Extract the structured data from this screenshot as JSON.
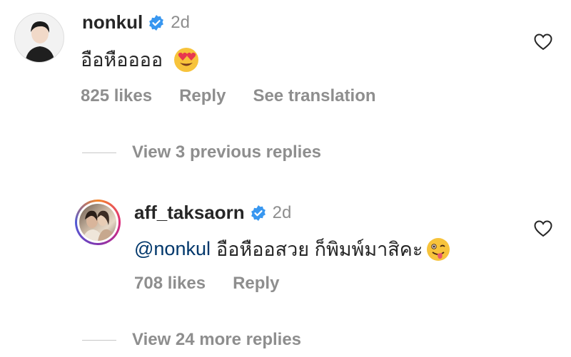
{
  "comments": [
    {
      "username": "nonkul",
      "time": "2d",
      "text": "อือหืออออ",
      "emoji": "heart-eyes-emoji",
      "likes": "825 likes",
      "reply": "Reply",
      "translate": "See translation"
    }
  ],
  "view_previous": "View 3 previous replies",
  "reply_comment": {
    "username": "aff_taksaorn",
    "time": "2d",
    "mention": "@nonkul",
    "text": "อือหืออสวย ก็พิมพ์มาสิคะ",
    "emoji": "winking-tongue-emoji",
    "likes": "708 likes",
    "reply": "Reply"
  },
  "view_more": "View 24 more replies",
  "colors": {
    "verified_blue": "#3897f0",
    "mention_blue": "#00376b",
    "secondary_gray": "#8e8e8e"
  }
}
